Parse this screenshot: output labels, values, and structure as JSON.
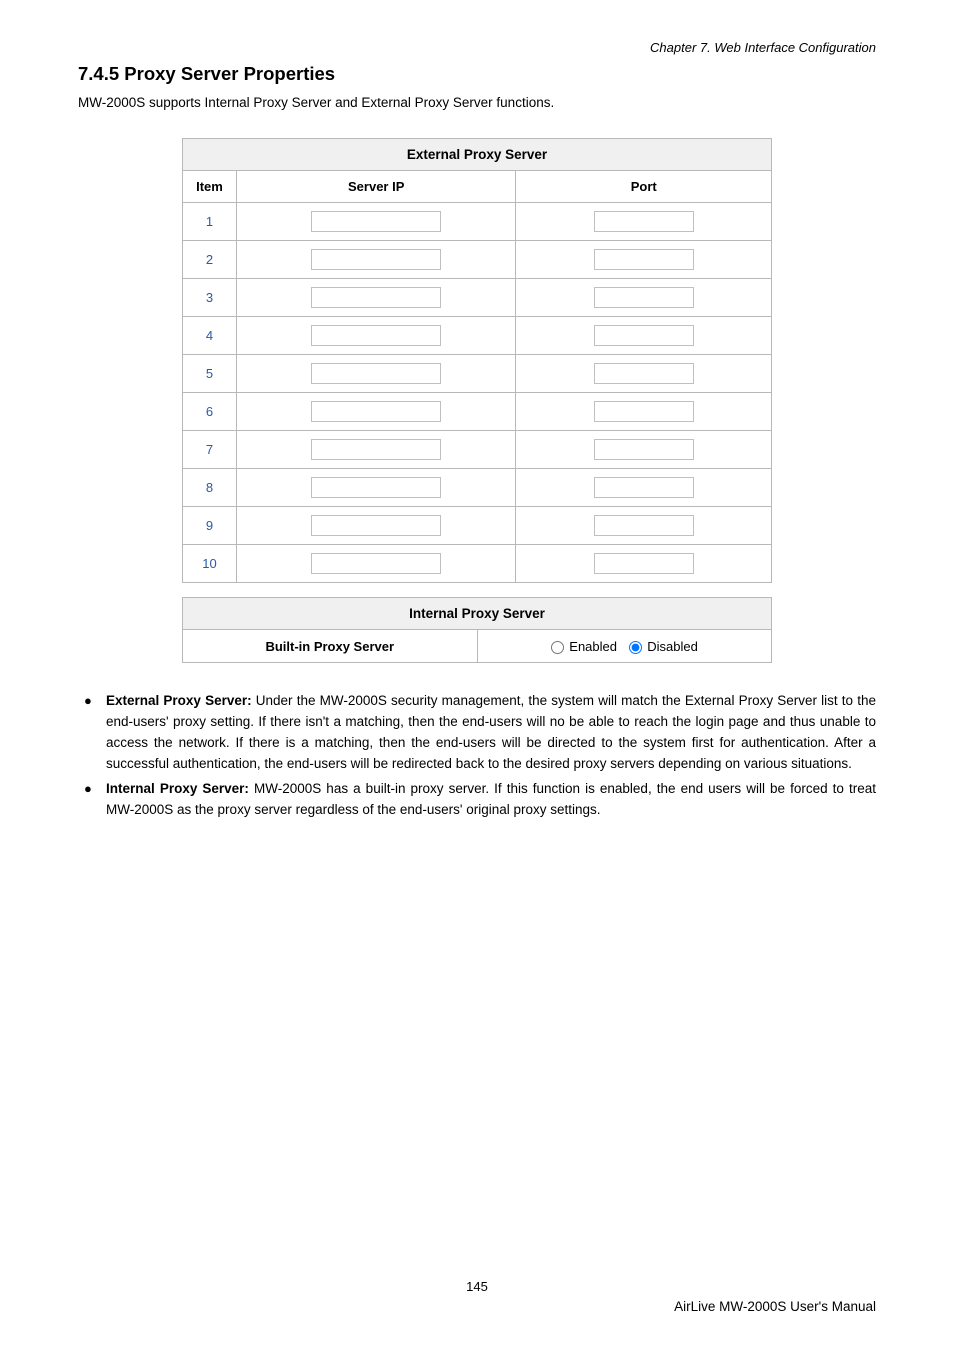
{
  "header": {
    "chapter": "Chapter 7.   Web Interface Configuration"
  },
  "section": {
    "title": "7.4.5  Proxy Server Properties",
    "intro": "MW-2000S supports Internal Proxy Server and External Proxy Server functions."
  },
  "ext_table": {
    "title": "External Proxy Server",
    "col_item": "Item",
    "col_ip": "Server IP",
    "col_port": "Port",
    "rows": [
      {
        "n": "1",
        "ip": "",
        "port": ""
      },
      {
        "n": "2",
        "ip": "",
        "port": ""
      },
      {
        "n": "3",
        "ip": "",
        "port": ""
      },
      {
        "n": "4",
        "ip": "",
        "port": ""
      },
      {
        "n": "5",
        "ip": "",
        "port": ""
      },
      {
        "n": "6",
        "ip": "",
        "port": ""
      },
      {
        "n": "7",
        "ip": "",
        "port": ""
      },
      {
        "n": "8",
        "ip": "",
        "port": ""
      },
      {
        "n": "9",
        "ip": "",
        "port": ""
      },
      {
        "n": "10",
        "ip": "",
        "port": ""
      }
    ]
  },
  "int_table": {
    "title": "Internal Proxy Server",
    "label": "Built-in Proxy Server",
    "enabled_label": "Enabled",
    "disabled_label": "Disabled",
    "selected": "disabled"
  },
  "bullets": {
    "b1_strong": "External Proxy Server:",
    "b1_text": " Under the MW-2000S security management, the system will match the External Proxy Server list to the end-users' proxy setting. If there isn't a matching, then the end-users will no be able to reach the login page and thus unable to access the network. If there is a matching, then the end-users will be directed to the system first for authentication. After a successful authentication, the end-users will be redirected back to the desired proxy servers depending on various situations.",
    "b2_strong": "Internal Proxy Server:",
    "b2_text": " MW-2000S has a built-in proxy server. If this function is enabled, the end users will be forced to treat MW-2000S as the proxy server regardless of the end-users' original proxy settings."
  },
  "footer": {
    "page": "145",
    "right": "AirLive  MW-2000S  User's  Manual"
  }
}
